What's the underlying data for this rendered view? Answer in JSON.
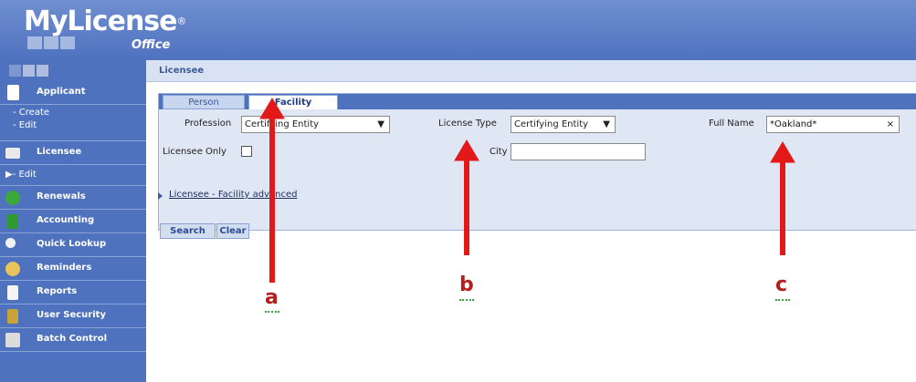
{
  "app": {
    "name": "MyLicense",
    "registered": "®",
    "edition": "Office"
  },
  "breadcrumb": "Licensee",
  "sidebar": {
    "items": [
      {
        "label": "Applicant",
        "icon": "document-icon"
      },
      {
        "sub": [
          "- Create",
          "- Edit"
        ]
      },
      {
        "label": "Licensee",
        "icon": "list-icon"
      },
      {
        "sub": [
          "▶- Edit"
        ]
      },
      {
        "label": "Renewals",
        "icon": "refresh-icon"
      },
      {
        "label": "Accounting",
        "icon": "dollar-icon"
      },
      {
        "label": "Quick Lookup",
        "icon": "magnifier-icon"
      },
      {
        "label": "Reminders",
        "icon": "people-icon"
      },
      {
        "label": "Reports",
        "icon": "report-icon"
      },
      {
        "label": "User Security",
        "icon": "lock-icon"
      },
      {
        "label": "Batch Control",
        "icon": "printer-icon"
      }
    ]
  },
  "tabs": {
    "person": "Person",
    "facility": "Facility"
  },
  "form": {
    "profession_label": "Profession",
    "profession_value": "Certifying Entity",
    "license_type_label": "License Type",
    "license_type_value": "Certifying Entity",
    "full_name_label": "Full Name",
    "full_name_value": "*Oakland*",
    "licensee_only_label": "Licensee Only",
    "city_label": "City",
    "city_value": "",
    "advanced_link": "Licensee - Facility advanced"
  },
  "buttons": {
    "search": "Search",
    "clear": "Clear"
  },
  "annotations": {
    "a": "a",
    "b": "b",
    "c": "c"
  },
  "colors": {
    "header": "#4f72bf",
    "arrow": "#e31919",
    "panel": "#dfe6f4"
  }
}
